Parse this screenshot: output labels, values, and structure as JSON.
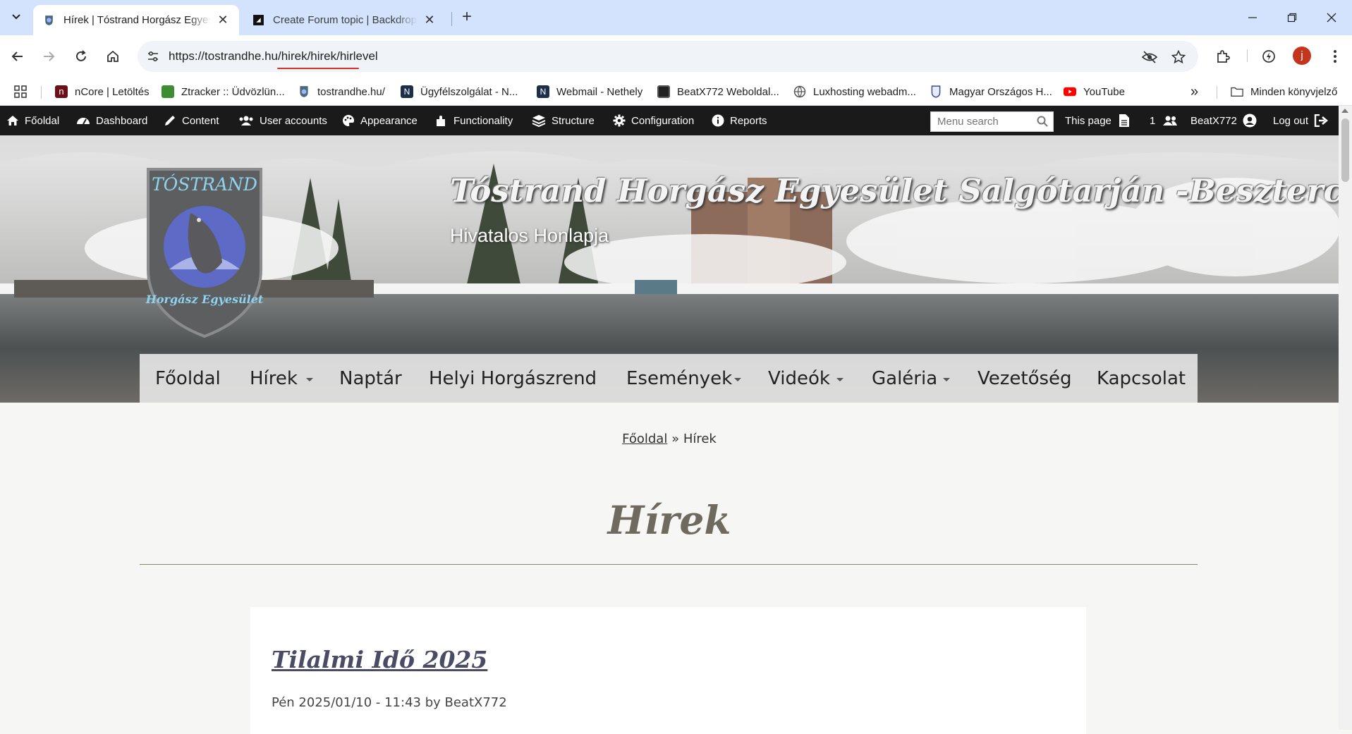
{
  "browser": {
    "tabs": [
      {
        "title": "Hírek | Tóstrand Horgász Egyesület",
        "close": "✕"
      },
      {
        "title": "Create Forum topic | Backdrop CMS",
        "close": "✕"
      }
    ],
    "new_tab": "+",
    "url": "https://tostrandhe.hu/hirek/hirek/hirlevel",
    "profile_initial": "j",
    "bookmarks": [
      {
        "label": "nCore | Letöltés"
      },
      {
        "label": "Ztracker :: Üdvözlün..."
      },
      {
        "label": "tostrandhe.hu/"
      },
      {
        "label": "Ügyfélszolgálat - N..."
      },
      {
        "label": "Webmail - Nethely"
      },
      {
        "label": "BeatX772 Weboldal..."
      },
      {
        "label": "Luxhosting webadm..."
      },
      {
        "label": "Magyar Országos H..."
      },
      {
        "label": "YouTube"
      }
    ],
    "bookmarks_overflow": "»",
    "all_bookmarks": "Minden könyvjelző"
  },
  "admin_bar": {
    "items": [
      "Főoldal",
      "Dashboard",
      "Content",
      "User accounts",
      "Appearance",
      "Functionality",
      "Structure",
      "Configuration",
      "Reports"
    ],
    "menu_search_placeholder": "Menu search",
    "this_page": "This page",
    "user_count": "1",
    "username": "BeatX772",
    "logout": "Log out"
  },
  "site": {
    "logo_top_text": "TÓSTRAND",
    "logo_bottom_text": "Horgász Egyesület",
    "name": "Tóstrand Horgász Egyesület Salgótarján -Beszterce",
    "slogan": "Hivatalos Honlapja",
    "nav": [
      "Főoldal",
      "Hírek",
      "Naptár",
      "Helyi Horgászrend",
      "Események",
      "Videók",
      "Galéria",
      "Vezetőség",
      "Kapcsolat"
    ]
  },
  "breadcrumb": {
    "home": "Főoldal",
    "separator": "»",
    "current": "Hírek"
  },
  "page_title": "Hírek",
  "node": {
    "title": "Tilalmi Idő 2025",
    "meta": "Pén 2025/01/10 - 11:43 by BeatX772"
  },
  "colors": {
    "tabstrip": "#d3e3fd",
    "admin_bar": "#1a1a1a",
    "title_text": "#6f6a60",
    "node_title": "#4a4c66"
  }
}
